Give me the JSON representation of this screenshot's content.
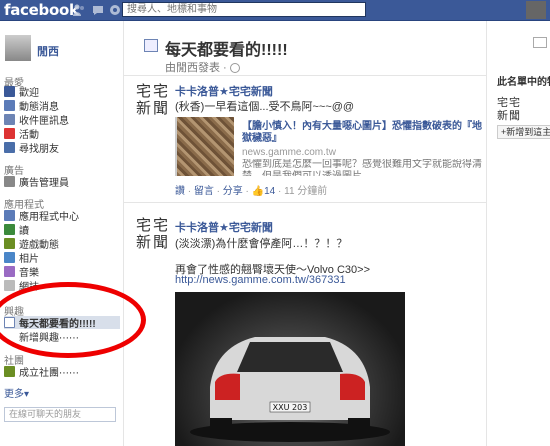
{
  "topbar": {
    "logo": "facebook",
    "search_placeholder": "搜尋人、地標和事物",
    "icons": [
      "friends-icon",
      "messages-icon",
      "notifications-icon"
    ]
  },
  "left": {
    "user_name": "閒西",
    "sections": {
      "favorites": "最愛",
      "pages": "廣告",
      "apps": "應用程式",
      "groups": "社團",
      "chat": "社團"
    },
    "favorites": [
      {
        "label": "歡迎",
        "icon": "welcome-icon"
      },
      {
        "label": "動態消息",
        "icon": "news-feed-icon"
      },
      {
        "label": "收件匣訊息",
        "icon": "messages-icon"
      },
      {
        "label": "活動",
        "icon": "events-icon"
      },
      {
        "label": "尋找朋友",
        "icon": "find-friends-icon"
      }
    ],
    "ads": [
      {
        "label": "廣告管理員",
        "icon": "ads-manager-icon"
      }
    ],
    "apps": [
      {
        "label": "應用程式中心",
        "icon": "app-center-icon"
      },
      {
        "label": "讀",
        "icon": "reads-icon"
      },
      {
        "label": "遊戲動態",
        "icon": "games-icon"
      },
      {
        "label": "相片",
        "icon": "photos-icon"
      },
      {
        "label": "音樂",
        "icon": "music-icon"
      },
      {
        "label": "網誌",
        "icon": "notes-icon"
      }
    ],
    "lists_title": "興趣",
    "lists": [
      {
        "label": "每天都要看的!!!!!",
        "icon": "list-icon",
        "selected": true
      },
      {
        "label": "新增興趣⋯⋯",
        "icon": "",
        "selected": false
      }
    ],
    "groups": [
      {
        "label": "成立社團⋯⋯",
        "icon": "create-group-icon"
      }
    ],
    "more": "更多▾",
    "chat_search": "在線可聊天的朋友"
  },
  "main": {
    "title": "每天都要看的!!!!!",
    "subtitle": "由閒西發表 · ",
    "posts": [
      {
        "logo": "宅宅\n新聞",
        "author": "卡卡洛普★宅宅新聞",
        "text": "(秋香)一早看這個...受不鳥阿~~~@@",
        "share": {
          "title": "【膽小慎入！內有大量噁心圖片】恐懼指數破表的『地獄穢惡』",
          "domain": "news.gamme.com.tw",
          "desc": "恐懼到底是怎麼一回事呢？感覺很難用文字就能說得清楚，但是我們可以透過圖片..."
        },
        "actions": {
          "like": "讚",
          "comment": "留言",
          "share": "分享",
          "count": "14",
          "time": "11 分鐘前"
        }
      },
      {
        "logo": "宅宅\n新聞",
        "author": "卡卡洛普★宅宅新聞",
        "text": "(淡淡漂)為什麼會停產阿…！？！？",
        "body": "再會了性感的翹臀壞天使～Volvo C30>>",
        "url": "http://news.gamme.com.tw/367331",
        "plate": "XXU 203"
      }
    ]
  },
  "right": {
    "title": "此名單中的特選",
    "logo": "宅宅\n新聞",
    "add_button": "+新增到這主題"
  },
  "annotation": {
    "color": "#e00000"
  }
}
